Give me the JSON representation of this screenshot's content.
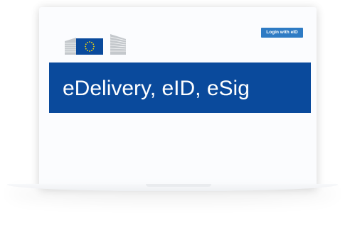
{
  "header": {
    "logo": {
      "icon": "european-commission-logo",
      "flag_color": "#0a4a9c",
      "stars_color": "#ffde00"
    },
    "login_button_label": "Login with eID"
  },
  "banner": {
    "title": "eDelivery, eID, eSig",
    "background_color": "#0a4a9c"
  },
  "colors": {
    "accent": "#2e7bc4",
    "page": "#fbfcfe"
  }
}
